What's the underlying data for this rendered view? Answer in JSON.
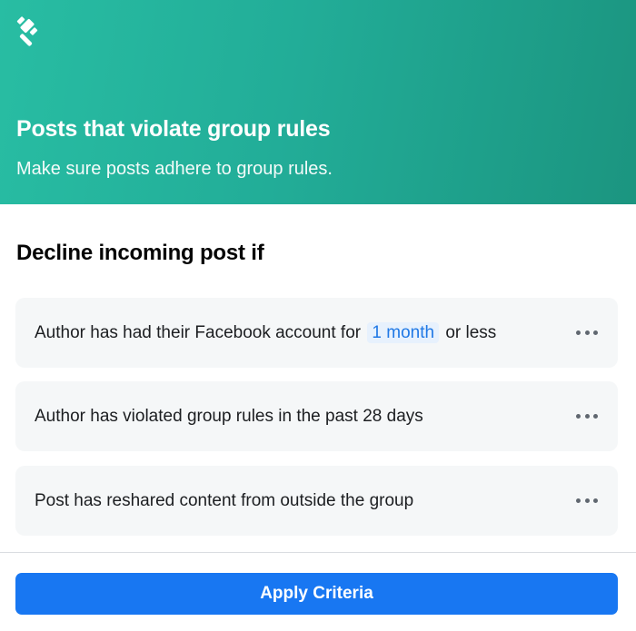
{
  "header": {
    "icon": "gavel-icon",
    "title": "Posts that violate group rules",
    "subtitle": "Make sure posts adhere to group rules.",
    "gradient": [
      "#28bda3",
      "#1b9580"
    ]
  },
  "section": {
    "title": "Decline incoming post if"
  },
  "criteria": [
    {
      "prefix": "Author has had their Facebook account for",
      "chip": "1 month",
      "suffix": "or less",
      "menu_icon": "more-options-icon"
    },
    {
      "text": "Author has violated group rules in the past 28 days",
      "menu_icon": "more-options-icon"
    },
    {
      "text": "Post has reshared content from outside the group",
      "menu_icon": "more-options-icon"
    }
  ],
  "footer": {
    "apply_label": "Apply Criteria",
    "button_color": "#1877f2"
  }
}
